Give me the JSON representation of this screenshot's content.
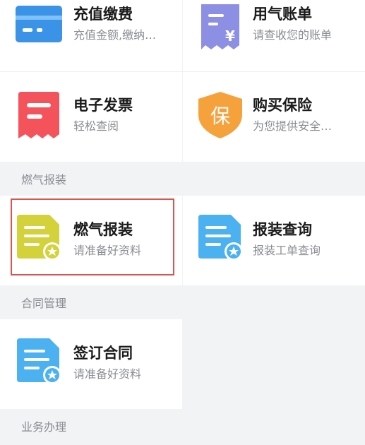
{
  "row1": {
    "left": {
      "title": "充值缴费",
      "subtitle": "充值金额,缴纳…"
    },
    "right": {
      "title": "用气账单",
      "subtitle": "请查收您的账单",
      "icon_text": "¥"
    }
  },
  "row2": {
    "left": {
      "title": "电子发票",
      "subtitle": "轻松查阅"
    },
    "right": {
      "title": "购买保险",
      "subtitle": "为您提供安全…",
      "icon_text": "保"
    }
  },
  "sections": {
    "gas_install": "燃气报装",
    "contract": "合同管理",
    "business": "业务办理"
  },
  "row3": {
    "left": {
      "title": "燃气报装",
      "subtitle": "请准备好资料"
    },
    "right": {
      "title": "报装查询",
      "subtitle": "报装工单查询"
    }
  },
  "row4": {
    "left": {
      "title": "签订合同",
      "subtitle": "请准备好资料"
    }
  },
  "colors": {
    "recharge_blue": "#3a93e6",
    "bill_purple": "#8d8fe4",
    "invoice_red": "#f5535b",
    "insurance_orange": "#f6a23c",
    "gas_yellow": "#d3d23a",
    "doc_blue": "#4cb1f1",
    "highlight_red": "#d9534f"
  }
}
